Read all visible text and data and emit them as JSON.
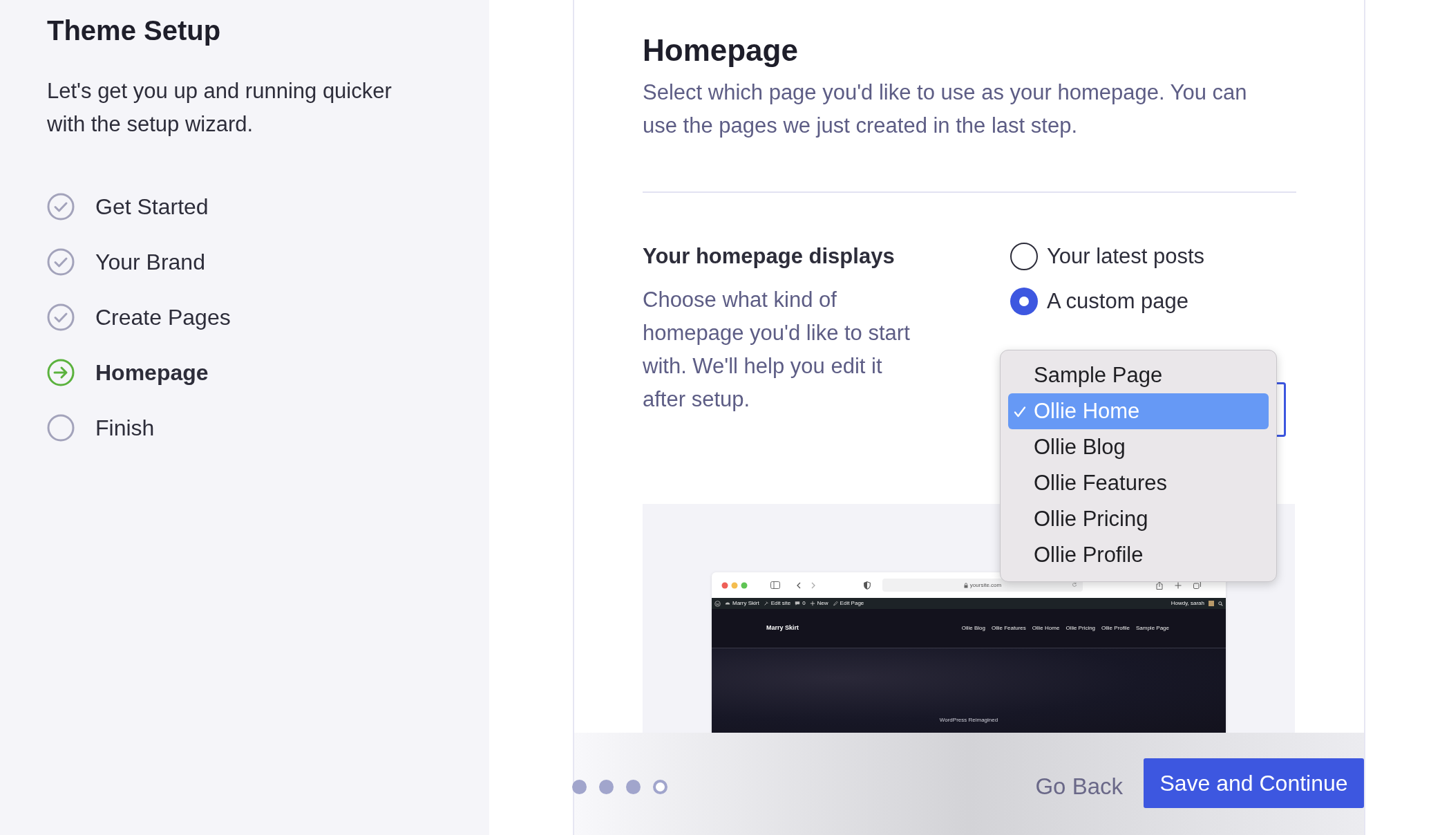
{
  "sidebar": {
    "title": "Theme Setup",
    "description": "Let's get you up and running quicker with the setup wizard.",
    "steps": [
      {
        "label": "Get Started",
        "kind": "done"
      },
      {
        "label": "Your Brand",
        "kind": "done"
      },
      {
        "label": "Create Pages",
        "kind": "done"
      },
      {
        "label": "Homepage",
        "kind": "current"
      },
      {
        "label": "Finish",
        "kind": "todo"
      }
    ]
  },
  "main": {
    "heading": "Homepage",
    "description": "Select which page you'd like to use as your homepage. You can use the pages we just created in the last step.",
    "setting": {
      "label": "Your homepage displays",
      "description": "Choose what kind of homepage you'd like to start with. We'll help you edit it after setup.",
      "options": [
        {
          "label": "Your latest posts",
          "selected": false
        },
        {
          "label": "A custom page",
          "selected": true
        }
      ]
    },
    "page_menu": {
      "options": [
        {
          "label": "Sample Page",
          "selected": false
        },
        {
          "label": "Ollie Home",
          "selected": true
        },
        {
          "label": "Ollie Blog",
          "selected": false
        },
        {
          "label": "Ollie Features",
          "selected": false
        },
        {
          "label": "Ollie Pricing",
          "selected": false
        },
        {
          "label": "Ollie Profile",
          "selected": false
        }
      ]
    },
    "preview": {
      "address": "yoursite.com",
      "admin_bar": [
        {
          "kind": "site",
          "label": "Marry Skirt"
        },
        {
          "kind": "edit_site",
          "label": "Edit site"
        },
        {
          "kind": "comments",
          "label": "0"
        },
        {
          "kind": "new",
          "label": "New"
        },
        {
          "kind": "edit_page",
          "label": "Edit Page"
        }
      ],
      "greeting": "Howdy, sarah",
      "site_title": "Marry Skirt",
      "nav": [
        "Ollie Blog",
        "Ollie Features",
        "Ollie Home",
        "Ollie Pricing",
        "Ollie Profile",
        "Sample Page"
      ],
      "tagline": "WordPress Reimagined"
    }
  },
  "footer": {
    "progress": [
      {
        "filled": true
      },
      {
        "filled": true
      },
      {
        "filled": true
      },
      {
        "filled": false
      }
    ],
    "back": "Go Back",
    "save": "Save and Continue"
  }
}
